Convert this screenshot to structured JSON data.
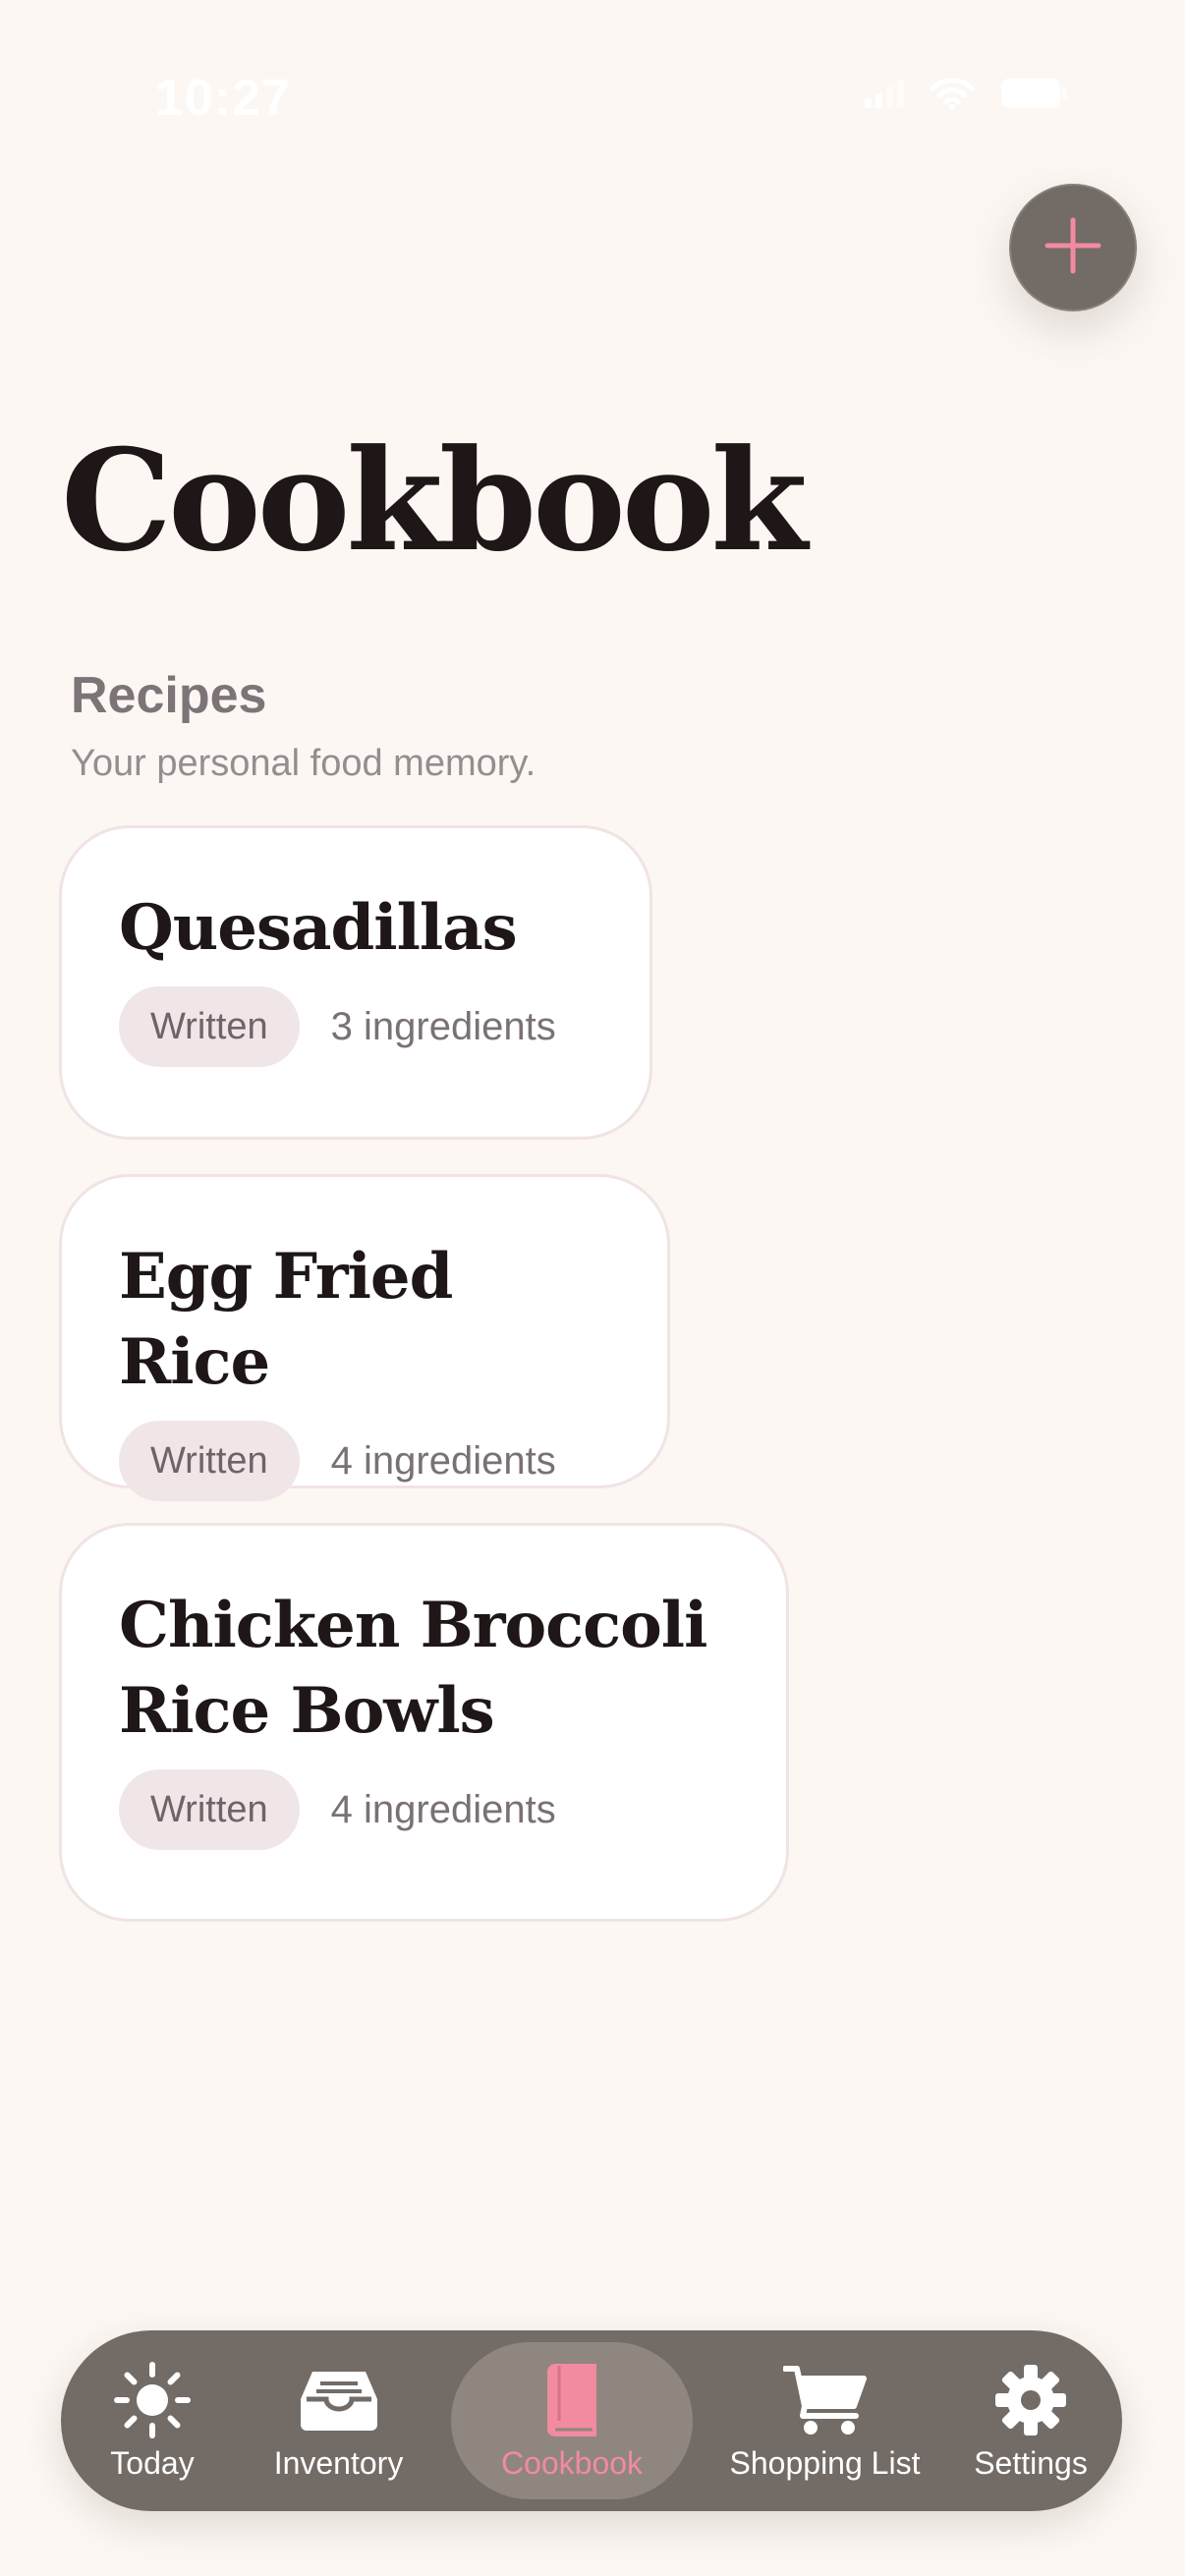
{
  "status_bar": {
    "time": "10:27",
    "signal_icon": "cellular-signal-icon",
    "wifi_icon": "wifi-icon",
    "battery_icon": "battery-icon"
  },
  "header": {
    "add_button_icon": "plus-icon",
    "title": "Cookbook"
  },
  "section": {
    "title": "Recipes",
    "subtitle": "Your personal food memory."
  },
  "recipes": [
    {
      "name": "Quesadillas",
      "badge": "Written",
      "ingredients": "3 ingredients"
    },
    {
      "name": "Egg Fried Rice",
      "badge": "Written",
      "ingredients": "4 ingredients"
    },
    {
      "name": "Chicken Broccoli\nRice Bowls",
      "badge": "Written",
      "ingredients": "4 ingredients"
    }
  ],
  "tab_bar": {
    "items": [
      {
        "label": "Today",
        "icon": "sun-icon"
      },
      {
        "label": "Inventory",
        "icon": "inbox-tray-icon"
      },
      {
        "label": "Cookbook",
        "icon": "book-icon",
        "active": true
      },
      {
        "label": "Shopping List",
        "icon": "cart-icon"
      },
      {
        "label": "Settings",
        "icon": "gear-icon"
      }
    ]
  },
  "colors": {
    "background": "#fcf7f3",
    "accent": "#f28aa0",
    "tab_bar": "#736b66",
    "card": "#ffffff",
    "badge": "#f0e6e8"
  }
}
